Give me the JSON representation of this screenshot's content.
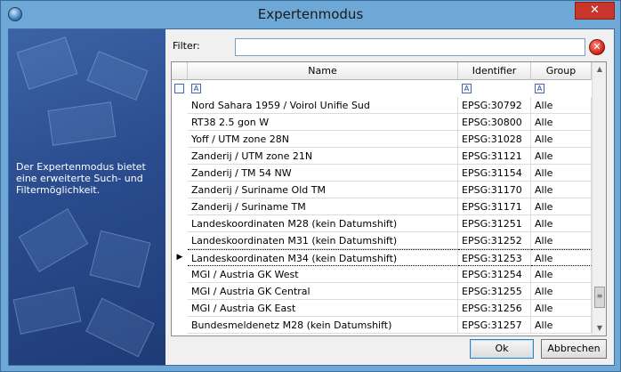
{
  "window": {
    "title": "Expertenmodus",
    "close_glyph": "✕"
  },
  "sidebar": {
    "description": "Der Expertenmodus bietet eine erweiterte Such- und Filtermöglichkeit."
  },
  "filter": {
    "label": "Filter:",
    "value": "",
    "clear_glyph": "✕"
  },
  "grid": {
    "columns": [
      "Name",
      "Identifier",
      "Group"
    ],
    "filter_glyph": "A",
    "rows": [
      {
        "name": "Nord Sahara 1959 / Voirol Unifie Sud",
        "id": "EPSG:30792",
        "group": "Alle"
      },
      {
        "name": "RT38 2.5 gon W",
        "id": "EPSG:30800",
        "group": "Alle"
      },
      {
        "name": "Yoff / UTM zone 28N",
        "id": "EPSG:31028",
        "group": "Alle"
      },
      {
        "name": "Zanderij / UTM zone 21N",
        "id": "EPSG:31121",
        "group": "Alle"
      },
      {
        "name": "Zanderij / TM 54 NW",
        "id": "EPSG:31154",
        "group": "Alle"
      },
      {
        "name": "Zanderij / Suriname Old TM",
        "id": "EPSG:31170",
        "group": "Alle"
      },
      {
        "name": "Zanderij / Suriname TM",
        "id": "EPSG:31171",
        "group": "Alle"
      },
      {
        "name": "Landeskoordinaten M28 (kein Datumshift)",
        "id": "EPSG:31251",
        "group": "Alle"
      },
      {
        "name": "Landeskoordinaten M31 (kein Datumshift)",
        "id": "EPSG:31252",
        "group": "Alle"
      },
      {
        "name": "Landeskoordinaten M34 (kein Datumshift)",
        "id": "EPSG:31253",
        "group": "Alle",
        "selected": true
      },
      {
        "name": "MGI / Austria GK West",
        "id": "EPSG:31254",
        "group": "Alle"
      },
      {
        "name": "MGI / Austria GK Central",
        "id": "EPSG:31255",
        "group": "Alle"
      },
      {
        "name": "MGI / Austria GK East",
        "id": "EPSG:31256",
        "group": "Alle"
      },
      {
        "name": "Bundesmeldenetz M28 (kein Datumshift)",
        "id": "EPSG:31257",
        "group": "Alle"
      }
    ]
  },
  "buttons": {
    "ok": "Ok",
    "cancel": "Abbrechen"
  }
}
